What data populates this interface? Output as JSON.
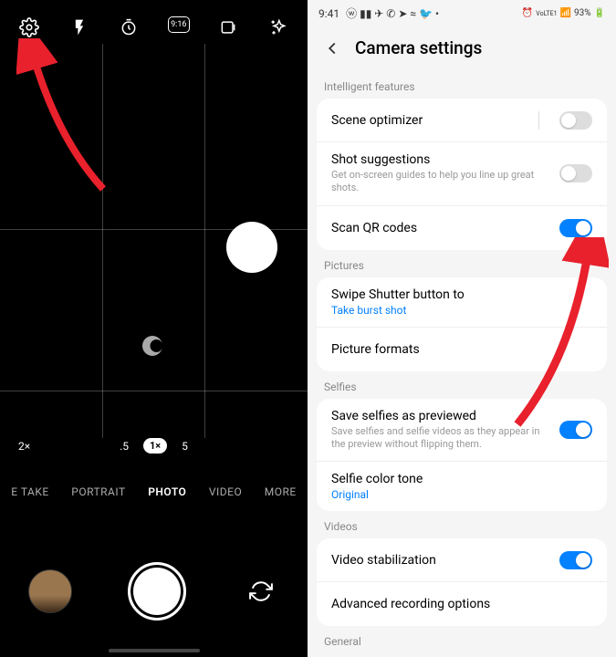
{
  "camera": {
    "zoom": {
      "far": "2×",
      "low": ".5",
      "mid": "1×",
      "high": "5"
    },
    "modes": {
      "take": "E TAKE",
      "portrait": "PORTRAIT",
      "photo": "PHOTO",
      "video": "VIDEO",
      "more": "MORE"
    }
  },
  "status": {
    "time": "9:41",
    "lte": "VoLTE1",
    "battery": "93%"
  },
  "settings": {
    "title": "Camera settings",
    "sections": {
      "intelligent": "Intelligent features",
      "pictures": "Pictures",
      "selfies": "Selfies",
      "videos": "Videos",
      "general": "General"
    },
    "scene_optimizer": "Scene optimizer",
    "shot_suggestions": {
      "title": "Shot suggestions",
      "sub": "Get on-screen guides to help you line up great shots."
    },
    "scan_qr": "Scan QR codes",
    "swipe_shutter": {
      "title": "Swipe Shutter button to",
      "link": "Take burst shot"
    },
    "picture_formats": "Picture formats",
    "save_selfies": {
      "title": "Save selfies as previewed",
      "sub": "Save selfies and selfie videos as they appear in the preview without flipping them."
    },
    "selfie_tone": {
      "title": "Selfie color tone",
      "link": "Original"
    },
    "video_stab": "Video stabilization",
    "advanced_rec": "Advanced recording options"
  }
}
